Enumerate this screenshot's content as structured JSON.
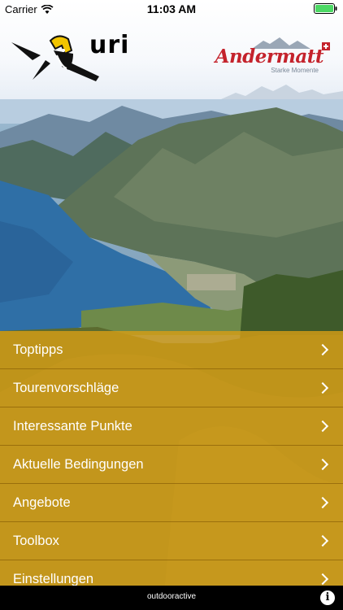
{
  "status_bar": {
    "carrier": "Carrier",
    "time": "11:03 AM"
  },
  "header": {
    "app_logo_text": "uri",
    "partner_name": "Andermatt",
    "partner_tagline": "Starke Momente"
  },
  "menu": {
    "items": [
      {
        "label": "Toptipps"
      },
      {
        "label": "Tourenvorschläge"
      },
      {
        "label": "Interessante Punkte"
      },
      {
        "label": "Aktuelle Bedingungen"
      },
      {
        "label": "Angebote"
      },
      {
        "label": "Toolbox"
      },
      {
        "label": "Einstellungen"
      }
    ]
  },
  "footer": {
    "brand": "outdooractive",
    "info_icon": "info-icon"
  },
  "colors": {
    "menu_overlay": "#d69e16",
    "partner_red": "#c4232c",
    "footer_bg": "#000000"
  }
}
